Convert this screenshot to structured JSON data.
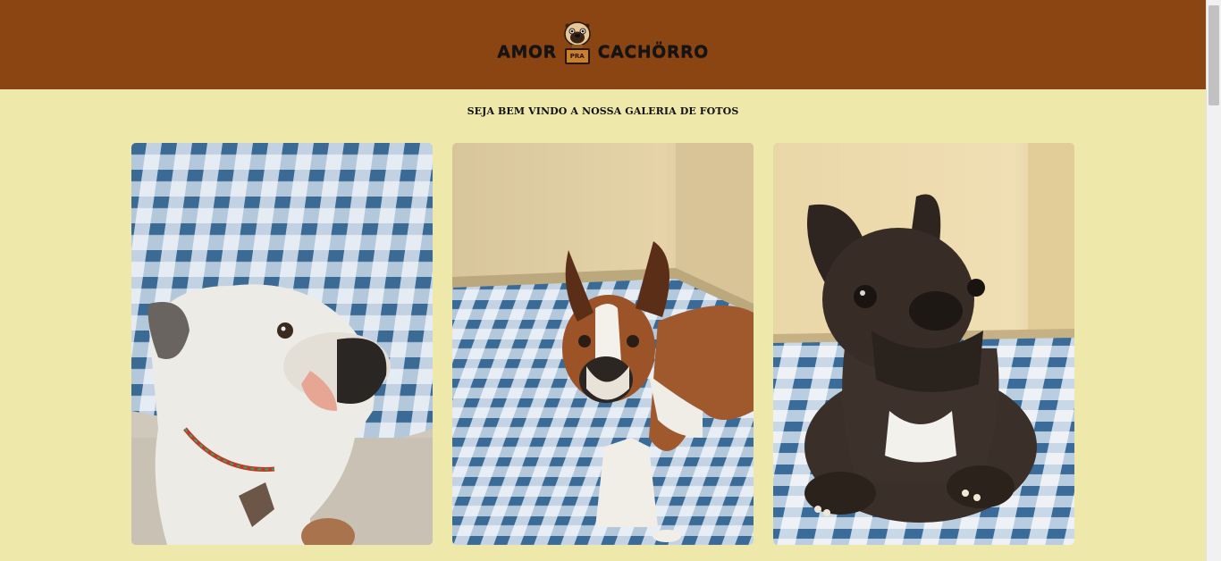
{
  "header": {
    "logo": {
      "word_left": "AMOR",
      "badge": "PRA",
      "word_right": "CACHÖRRO",
      "icon": "pug-dog-icon"
    },
    "background_color": "#8b4513"
  },
  "main": {
    "welcome_text": "SEJA BEM VINDO A NOSSA GALERIA DE FOTOS",
    "background_color": "#eee8aa"
  },
  "gallery": {
    "photos": [
      {
        "subject": "white-french-bulldog-photo"
      },
      {
        "subject": "fawn-and-white-french-bulldog-photo"
      },
      {
        "subject": "brindle-french-bulldog-photo"
      }
    ]
  }
}
